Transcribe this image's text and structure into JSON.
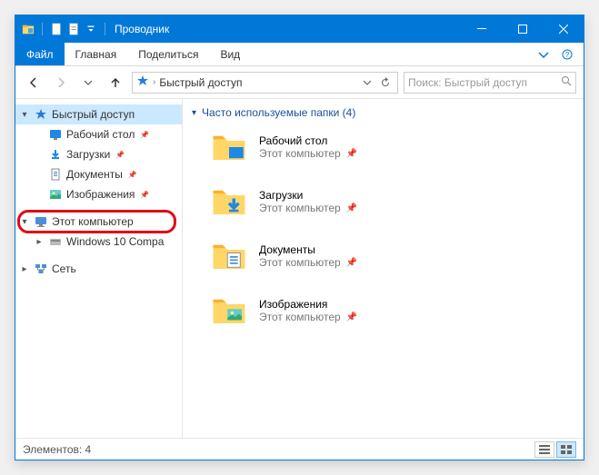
{
  "titlebar": {
    "title": "Проводник"
  },
  "ribbon": {
    "file": "Файл",
    "home": "Главная",
    "share": "Поделиться",
    "view": "Вид"
  },
  "address": {
    "location": "Быстрый доступ"
  },
  "search": {
    "placeholder": "Поиск: Быстрый доступ"
  },
  "sidebar": {
    "quick_access": "Быстрый доступ",
    "items": [
      {
        "label": "Рабочий стол"
      },
      {
        "label": "Загрузки"
      },
      {
        "label": "Документы"
      },
      {
        "label": "Изображения"
      }
    ],
    "this_pc": "Этот компьютер",
    "drive": "Windows 10 Compa",
    "network": "Сеть"
  },
  "content": {
    "section_title": "Часто используемые папки (4)",
    "sub_location": "Этот компьютер",
    "folders": [
      {
        "name": "Рабочий стол"
      },
      {
        "name": "Загрузки"
      },
      {
        "name": "Документы"
      },
      {
        "name": "Изображения"
      }
    ]
  },
  "statusbar": {
    "count": "Элементов: 4"
  }
}
